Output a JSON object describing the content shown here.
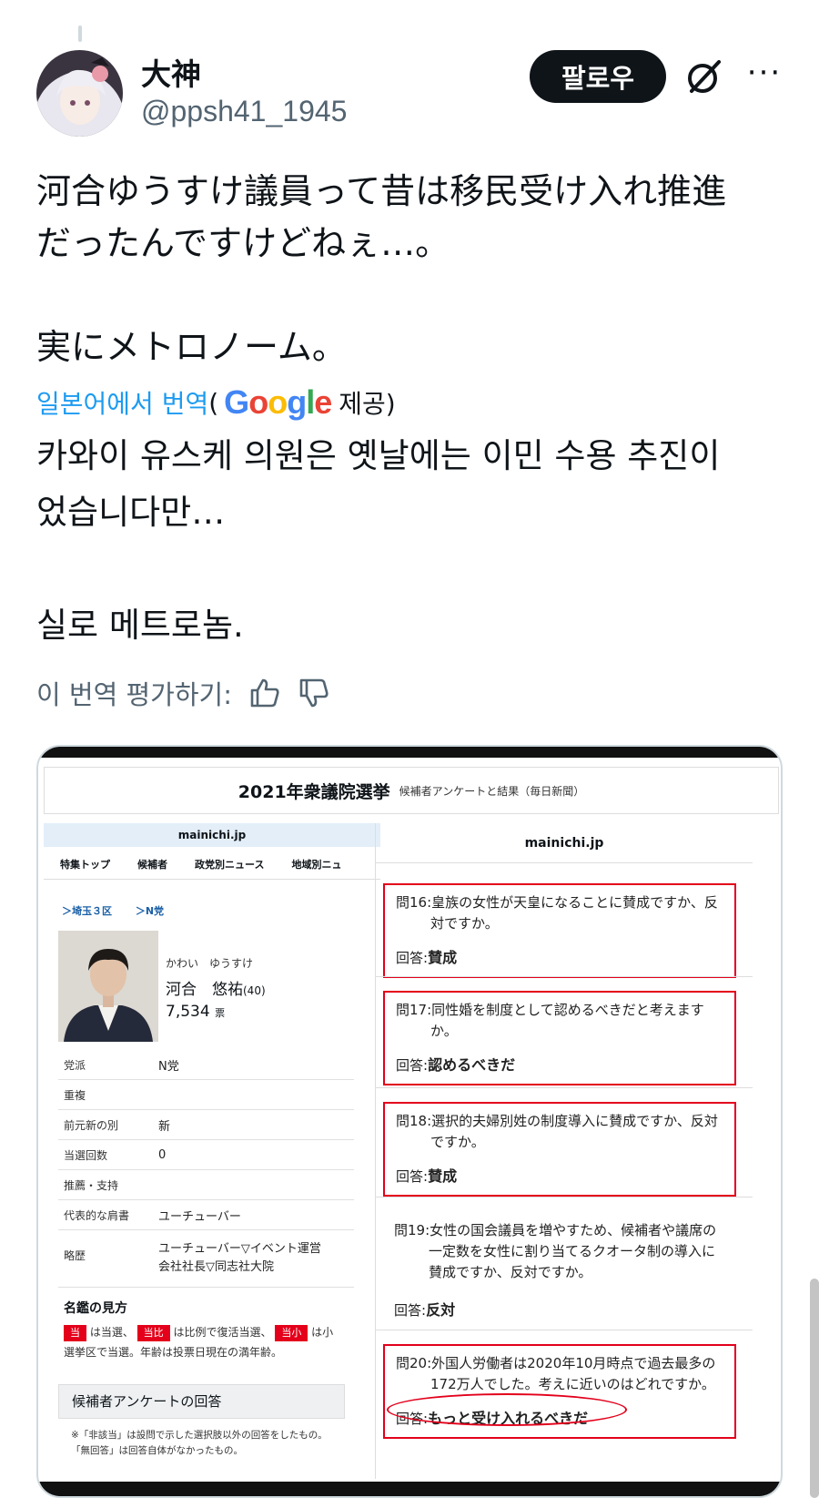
{
  "post": {
    "display_name": "大神",
    "handle": "@ppsh41_1945",
    "follow_label": "팔로우",
    "more_label": "···",
    "original_text": "河合ゆうすけ議員って昔は移民受け入れ推進\nだったんですけどねぇ…。\n\n実にメトロノーム。",
    "translation_link": "일본어에서 번역",
    "translation_open": "(",
    "translation_provider": "Google",
    "translation_suffix": "제공)",
    "translated_text": "카와이 유스케 의원은 옛날에는 이민 수용 추진이\n었습니다만…\n\n실로 메트로놈.",
    "rate_label": "이 번역 평가하기:"
  },
  "image": {
    "title": "2021年衆議院選挙",
    "subtitle": "候補者アンケートと結果（毎日新聞）",
    "left": {
      "site": "mainichi.jp",
      "nav": [
        "特集トップ",
        "候補者",
        "政党別ニュース",
        "地域別ニュ"
      ],
      "breadcrumb_district": "埼玉３区",
      "breadcrumb_party": "N党",
      "kana": "かわい　ゆうすけ",
      "name": "河合　悠祐",
      "age": "(40)",
      "votes": "7,534",
      "votes_unit": "票",
      "rows": [
        {
          "k": "党派",
          "v": "N党"
        },
        {
          "k": "重複",
          "v": ""
        },
        {
          "k": "前元新の別",
          "v": "新"
        },
        {
          "k": "当選回数",
          "v": "0"
        },
        {
          "k": "推薦・支持",
          "v": ""
        },
        {
          "k": "代表的な肩書",
          "v": "ユーチューバー"
        },
        {
          "k": "略歴",
          "v": "ユーチューバー▽イベント運営\n会社社長▽同志社大院"
        }
      ],
      "legend_title": "名鑑の見方",
      "tag_win": "当",
      "legend_1": "は当選、",
      "tag_revival": "当比",
      "legend_2": "は比例で復活当選、",
      "tag_small": "当小",
      "legend_3": "は小",
      "legend_4": "選挙区で当選。年齢は投票日現在の満年齢。",
      "answers_heading": "候補者アンケートの回答",
      "note": "※「非該当」は設問で示した選択肢以外の回答をしたもの。\n「無回答」は回答自体がなかったもの。"
    },
    "right": {
      "site": "mainichi.jp",
      "questions": [
        {
          "q": "問16:皇族の女性が天皇になることに賛成ですか、反対ですか。",
          "a_label": "回答:",
          "a": "賛成"
        },
        {
          "q": "問17:同性婚を制度として認めるべきだと考えますか。",
          "a_label": "回答:",
          "a": "認めるべきだ"
        },
        {
          "q": "問18:選択的夫婦別姓の制度導入に賛成ですか、反対ですか。",
          "a_label": "回答:",
          "a": "賛成"
        },
        {
          "q": "問19:女性の国会議員を増やすため、候補者や議席の一定数を女性に割り当てるクオータ制の導入に賛成ですか、反対ですか。",
          "a_label": "回答:",
          "a": "反対"
        },
        {
          "q": "問20:外国人労働者は2020年10月時点で過去最多の172万人でした。考えに近いのはどれですか。",
          "a_label": "回答:",
          "a": "もっと受け入れるべきだ"
        }
      ]
    }
  },
  "colors": {
    "link": "#1d9bf0",
    "secondary_text": "#536471",
    "highlight_red": "#e3001b"
  }
}
